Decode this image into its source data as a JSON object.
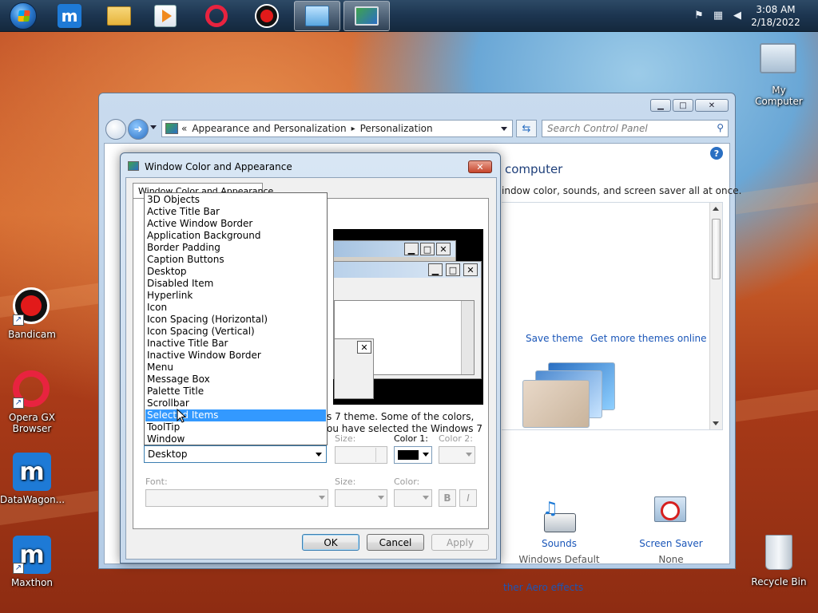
{
  "taskbar": {
    "clock_time": "3:08 AM",
    "clock_date": "2/18/2022",
    "buttons": [
      "start-orb",
      "maxthon",
      "file-explorer",
      "media-player",
      "opera",
      "bandicam",
      "control-panel",
      "display-settings"
    ]
  },
  "desktop_icons": {
    "my_computer": "My Computer",
    "bandicam": "Bandicam",
    "opera_line1": "Opera GX",
    "opera_line2": "Browser",
    "datawagon": "DataWagon...",
    "maxthon": "Maxthon",
    "recycle_bin": "Recycle Bin"
  },
  "control_panel": {
    "address_prefix": "«",
    "breadcrumb_1": "Appearance and Personalization",
    "breadcrumb_sep": "▸",
    "breadcrumb_2": "Personalization",
    "search_placeholder": "Search Control Panel",
    "heading": "computer",
    "description": "indow color, sounds, and screen saver all at once.",
    "save_theme": "Save theme",
    "get_more_themes": "Get more themes online",
    "sounds_label": "Sounds",
    "sounds_value": "Windows Default",
    "screen_saver_label": "Screen Saver",
    "screen_saver_value": "None",
    "aero_link": "ther Aero effects"
  },
  "dialog": {
    "title": "Window Color and Appearance",
    "tab_label": "Window Color and Appearance",
    "desc_line1": "s 7 theme.  Some of the colors,",
    "desc_line2": "ou have selected the Windows 7",
    "item_selected": "Desktop",
    "size_label": "Size:",
    "color1_label": "Color 1:",
    "color2_label": "Color 2:",
    "font_label": "Font:",
    "font_size_label": "Size:",
    "font_color_label": "Color:",
    "bold_label": "B",
    "italic_label": "I",
    "ok_label": "OK",
    "cancel_label": "Cancel",
    "apply_label": "Apply",
    "color1_value": "#000000"
  },
  "item_list": [
    "3D Objects",
    "Active Title Bar",
    "Active Window Border",
    "Application Background",
    "Border Padding",
    "Caption Buttons",
    "Desktop",
    "Disabled Item",
    "Hyperlink",
    "Icon",
    "Icon Spacing (Horizontal)",
    "Icon Spacing (Vertical)",
    "Inactive Title Bar",
    "Inactive Window Border",
    "Menu",
    "Message Box",
    "Palette Title",
    "Scrollbar",
    "Selected Items",
    "ToolTip",
    "Window"
  ],
  "highlighted_item": "Selected Items",
  "colors": {
    "accent_blue": "#3399ff",
    "link_blue": "#1a56b8"
  }
}
